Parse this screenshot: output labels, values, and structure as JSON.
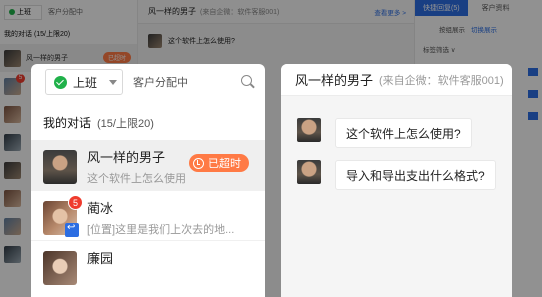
{
  "background": {
    "shift_label": "上班",
    "dist_label": "客户分配中",
    "my_conv": "我的对话 (15/上限20)",
    "rows": [
      {
        "name": "风一样的男子",
        "timeout": "已超时",
        "badge": ""
      },
      {
        "name": "",
        "timeout": "",
        "badge": "5"
      }
    ],
    "chat_title": "风一样的男子",
    "chat_src": "(来自企微：软件客服001)",
    "see_more": "查看更多 >",
    "message": "这个软件上怎么使用?",
    "tab_quick_reply": "快捷回复(5)",
    "tab_customer_info": "客户资料",
    "sub_by_group": "按组展示",
    "sub_switch": "切换展示",
    "tag_filter": "标签筛选 ∨"
  },
  "left_panel": {
    "shift_label": "上班",
    "dist_label": "客户分配中",
    "my_conv_title": "我的对话",
    "my_conv_count": "(15/上限20)",
    "conversations": [
      {
        "name": "风一样的男子",
        "preview": "这个软件上怎么使用",
        "timeout": "已超时",
        "badge": ""
      },
      {
        "name": "蔺冰",
        "preview": "[位置]这里是我们上次去的地...",
        "timeout": "",
        "badge": "5"
      },
      {
        "name": "廉园",
        "preview": "",
        "timeout": "",
        "badge": ""
      }
    ]
  },
  "right_panel": {
    "name": "风一样的男子",
    "source": "(来自企微：软件客服001)",
    "messages": [
      "这个软件上怎么使用?",
      "导入和导出支出什么格式?"
    ]
  },
  "colors": {
    "accent": "#2b6de2",
    "online": "#20b14a",
    "timeout": "#ff7a45",
    "badge": "#ef3b2d"
  }
}
